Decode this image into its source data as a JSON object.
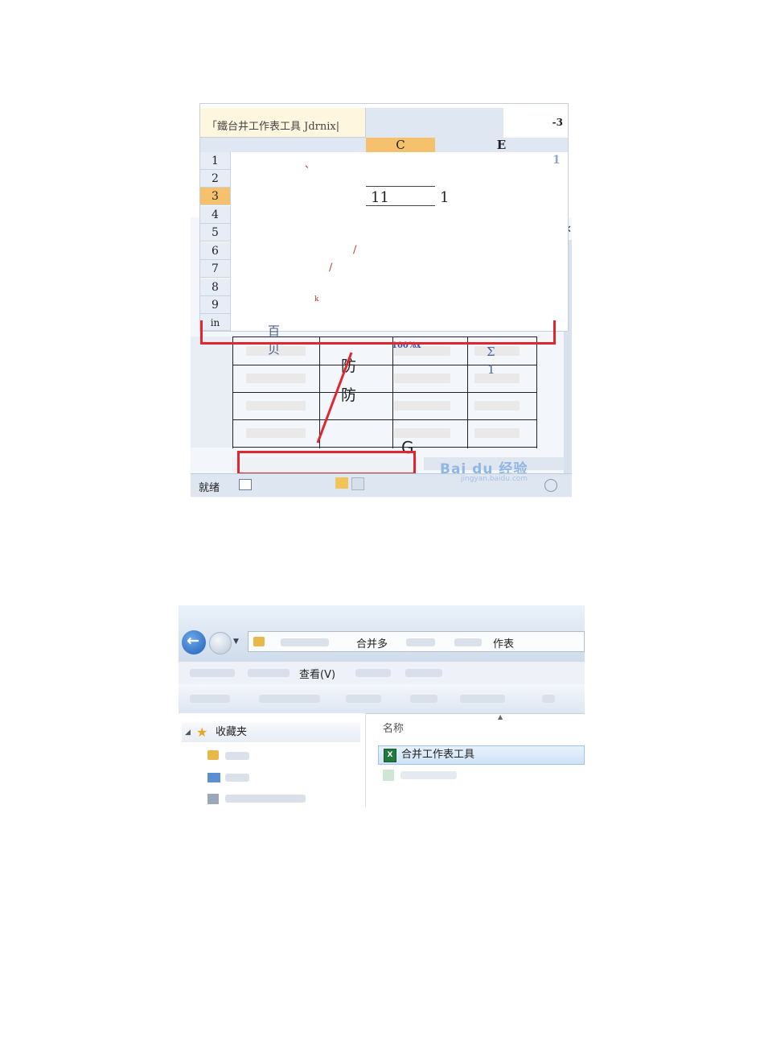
{
  "spreadsheet": {
    "name_box": "「鐵台井工作表工具 Jdrnix|",
    "corner_value": "-3",
    "columns": [
      "C",
      "E"
    ],
    "rows": [
      "1",
      "2",
      "3",
      "4",
      "5",
      "6",
      "7",
      "8",
      "9",
      "in"
    ],
    "right_value": "1",
    "mark_comma": "、",
    "mark_slash": "/",
    "mark_k": "k",
    "cell_value": "11",
    "cell_value_2": "1",
    "sheet_tab": "百",
    "sheet_tab_2": "贝",
    "zoom_text": "100%x",
    "sigma": "Σ",
    "sigma_sub": "1",
    "cell_char_1": "防",
    "cell_char_2": "防",
    "cell_char_g": "G",
    "status_text": "就绪",
    "watermark": "Bai du 经验",
    "watermark_sub": "jingyan.baidu.com",
    "colors": {
      "accent_red": "#e0262f",
      "selected_header": "#f6c16d"
    }
  },
  "explorer": {
    "address_folder": "合并多",
    "address_tail": "作表",
    "menu_view": "查看(V)",
    "favorites": "收藏夹",
    "column_name": "名称",
    "selected_file": "合并工作表工具",
    "icons": [
      "back-arrow-icon",
      "forward-arrow-icon",
      "folder-icon",
      "star-icon",
      "excel-file-icon"
    ]
  }
}
